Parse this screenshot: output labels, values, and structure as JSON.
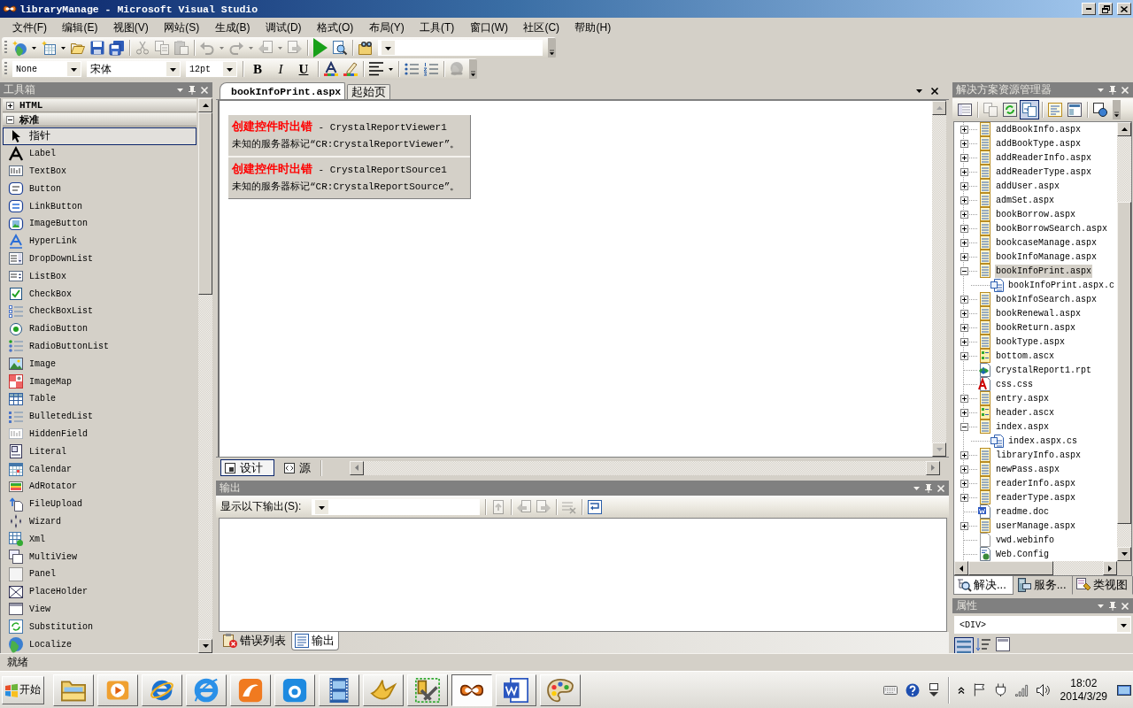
{
  "window": {
    "title": "libraryManage - Microsoft Visual Studio"
  },
  "menu": [
    "文件(F)",
    "编辑(E)",
    "视图(V)",
    "网站(S)",
    "生成(B)",
    "调试(D)",
    "格式(O)",
    "布局(Y)",
    "工具(T)",
    "窗口(W)",
    "社区(C)",
    "帮助(H)"
  ],
  "standard_toolbar": {
    "tool_groups": [
      [
        {
          "kind": "new-project",
          "disabled": false,
          "dropdown": true
        },
        {
          "kind": "add-item",
          "disabled": false,
          "dropdown": true
        },
        {
          "kind": "open",
          "disabled": false,
          "dropdown": false
        },
        {
          "kind": "save",
          "disabled": false,
          "dropdown": false
        },
        {
          "kind": "save-all",
          "disabled": false,
          "dropdown": false
        }
      ],
      [
        {
          "kind": "cut",
          "disabled": true,
          "dropdown": false
        },
        {
          "kind": "copy",
          "disabled": true,
          "dropdown": false
        },
        {
          "kind": "paste",
          "disabled": true,
          "dropdown": false
        }
      ],
      [
        {
          "kind": "undo",
          "disabled": true,
          "dropdown": true
        },
        {
          "kind": "redo",
          "disabled": true,
          "dropdown": true
        },
        {
          "kind": "back",
          "disabled": true,
          "dropdown": true
        },
        {
          "kind": "forward",
          "disabled": true,
          "dropdown": false
        }
      ],
      [
        {
          "kind": "start",
          "disabled": false,
          "dropdown": false
        },
        {
          "kind": "browse",
          "disabled": false,
          "dropdown": false
        }
      ],
      [
        {
          "kind": "find-in-files",
          "disabled": false,
          "dropdown": false
        }
      ]
    ]
  },
  "format_toolbar": {
    "block_format": "None",
    "font": "宋体",
    "size": "12pt",
    "styles": [
      {
        "label": "B",
        "kind": "bold"
      },
      {
        "label": "I",
        "kind": "italic"
      },
      {
        "label": "U",
        "kind": "underline"
      }
    ],
    "tool_groups": [
      [
        {
          "kind": "font-color",
          "disabled": false,
          "dropdown": false
        },
        {
          "kind": "highlight",
          "disabled": false,
          "dropdown": false
        }
      ],
      [
        {
          "kind": "align",
          "disabled": false,
          "dropdown": true
        }
      ],
      [
        {
          "kind": "bullets",
          "disabled": false,
          "dropdown": false
        },
        {
          "kind": "numbering",
          "disabled": false,
          "dropdown": false
        }
      ],
      [
        {
          "kind": "link",
          "disabled": true,
          "dropdown": false
        }
      ]
    ]
  },
  "toolbox": {
    "title": "工具箱",
    "groups": [
      {
        "label": "HTML",
        "expanded": false
      },
      {
        "label": "标准",
        "expanded": true,
        "items": [
          {
            "label": "指针",
            "kind": "pointer",
            "selected": true
          },
          {
            "label": "Label",
            "kind": "letter",
            "selected": false
          },
          {
            "label": "TextBox",
            "kind": "textbox",
            "selected": false
          },
          {
            "label": "Button",
            "kind": "button",
            "selected": false
          },
          {
            "label": "LinkButton",
            "kind": "linkbutton",
            "selected": false
          },
          {
            "label": "ImageButton",
            "kind": "imagebutton",
            "selected": false
          },
          {
            "label": "HyperLink",
            "kind": "hyperlink",
            "selected": false
          },
          {
            "label": "DropDownList",
            "kind": "dropdown",
            "selected": false
          },
          {
            "label": "ListBox",
            "kind": "listbox",
            "selected": false
          },
          {
            "label": "CheckBox",
            "kind": "checkbox",
            "selected": false
          },
          {
            "label": "CheckBoxList",
            "kind": "checklist",
            "selected": false
          },
          {
            "label": "RadioButton",
            "kind": "radio",
            "selected": false
          },
          {
            "label": "RadioButtonList",
            "kind": "radiolist",
            "selected": false
          },
          {
            "label": "Image",
            "kind": "image",
            "selected": false
          },
          {
            "label": "ImageMap",
            "kind": "imagemap",
            "selected": false
          },
          {
            "label": "Table",
            "kind": "table",
            "selected": false
          },
          {
            "label": "BulletedList",
            "kind": "bulletlist",
            "selected": false
          },
          {
            "label": "HiddenField",
            "kind": "hidden",
            "selected": false
          },
          {
            "label": "Literal",
            "kind": "literal",
            "selected": false
          },
          {
            "label": "Calendar",
            "kind": "calendar",
            "selected": false
          },
          {
            "label": "AdRotator",
            "kind": "adrotator",
            "selected": false
          },
          {
            "label": "FileUpload",
            "kind": "upload",
            "selected": false
          },
          {
            "label": "Wizard",
            "kind": "wizard",
            "selected": false
          },
          {
            "label": "Xml",
            "kind": "xml",
            "selected": false
          },
          {
            "label": "MultiView",
            "kind": "multiview",
            "selected": false
          },
          {
            "label": "Panel",
            "kind": "panel",
            "selected": false
          },
          {
            "label": "PlaceHolder",
            "kind": "placeholder",
            "selected": false
          },
          {
            "label": "View",
            "kind": "view",
            "selected": false
          },
          {
            "label": "Substitution",
            "kind": "substitution",
            "selected": false
          },
          {
            "label": "Localize",
            "kind": "localize",
            "selected": false
          }
        ]
      }
    ]
  },
  "editor": {
    "tabs": [
      {
        "label": "bookInfoPrint.aspx",
        "selected": true
      },
      {
        "label": "起始页",
        "selected": false
      }
    ],
    "errors": [
      {
        "title": "**创建控件时出错** - CrystalReportViewer1",
        "message": "未知的服务器标记“CR:CrystalReportViewer”。"
      },
      {
        "title": "**创建控件时出错** - CrystalReportSource1",
        "message": "未知的服务器标记“CR:CrystalReportSource”。"
      }
    ],
    "views": [
      {
        "label": "设计",
        "kind": "design",
        "selected": true
      },
      {
        "label": "源",
        "kind": "source",
        "selected": false
      }
    ]
  },
  "output": {
    "title": "输出",
    "filter_label": "显示以下输出(S):",
    "tool_groups": [
      [
        {
          "kind": "goto",
          "disabled": true
        }
      ],
      [
        {
          "kind": "prev",
          "disabled": true
        },
        {
          "kind": "next",
          "disabled": true
        }
      ],
      [
        {
          "kind": "clear",
          "disabled": true
        }
      ],
      [
        {
          "kind": "wrap",
          "disabled": false
        }
      ]
    ],
    "tabs": [
      {
        "label": "错误列表",
        "kind": "errors",
        "selected": false
      },
      {
        "label": "输出",
        "kind": "output",
        "selected": true
      }
    ]
  },
  "solution_explorer": {
    "title": "解决方案资源管理器",
    "tool_groups": [
      [
        {
          "kind": "properties",
          "disabled": false,
          "selected": false
        }
      ],
      [
        {
          "kind": "show-all",
          "disabled": true,
          "selected": false
        },
        {
          "kind": "refresh",
          "disabled": false,
          "selected": false
        },
        {
          "kind": "nest",
          "disabled": false,
          "selected": true
        }
      ],
      [
        {
          "kind": "view-code",
          "disabled": false,
          "selected": false
        },
        {
          "kind": "view-designer",
          "disabled": false,
          "selected": false
        }
      ],
      [
        {
          "kind": "copy-site",
          "disabled": false,
          "selected": false
        }
      ]
    ],
    "items": [
      {
        "label": "addBookInfo.aspx",
        "kind": "page",
        "expanded": false,
        "selected": false
      },
      {
        "label": "addBookType.aspx",
        "kind": "page",
        "expanded": false,
        "selected": false
      },
      {
        "label": "addReaderInfo.aspx",
        "kind": "page",
        "expanded": false,
        "selected": false
      },
      {
        "label": "addReaderType.aspx",
        "kind": "page",
        "expanded": false,
        "selected": false
      },
      {
        "label": "addUser.aspx",
        "kind": "page",
        "expanded": false,
        "selected": false
      },
      {
        "label": "admSet.aspx",
        "kind": "page",
        "expanded": false,
        "selected": false
      },
      {
        "label": "bookBorrow.aspx",
        "kind": "page",
        "expanded": false,
        "selected": false
      },
      {
        "label": "bookBorrowSearch.aspx",
        "kind": "page",
        "expanded": false,
        "selected": false
      },
      {
        "label": "bookcaseManage.aspx",
        "kind": "page",
        "expanded": false,
        "selected": false
      },
      {
        "label": "bookInfoManage.aspx",
        "kind": "page",
        "expanded": false,
        "selected": false
      },
      {
        "label": "bookInfoPrint.aspx",
        "kind": "page",
        "expanded": true,
        "selected": true,
        "children": [
          {
            "label": "bookInfoPrint.aspx.c",
            "kind": "code",
            "selected": false
          }
        ]
      },
      {
        "label": "bookInfoSearch.aspx",
        "kind": "page",
        "expanded": false,
        "selected": false
      },
      {
        "label": "bookRenewal.aspx",
        "kind": "page",
        "expanded": false,
        "selected": false
      },
      {
        "label": "bookReturn.aspx",
        "kind": "page",
        "expanded": false,
        "selected": false
      },
      {
        "label": "bookType.aspx",
        "kind": "page",
        "expanded": false,
        "selected": false
      },
      {
        "label": "bottom.ascx",
        "kind": "control",
        "expanded": false,
        "selected": false
      },
      {
        "label": "CrystalReport1.rpt",
        "kind": "report",
        "selected": false
      },
      {
        "label": "css.css",
        "kind": "stylesheet",
        "selected": false
      },
      {
        "label": "entry.aspx",
        "kind": "page",
        "expanded": false,
        "selected": false
      },
      {
        "label": "header.ascx",
        "kind": "control",
        "expanded": false,
        "selected": false
      },
      {
        "label": "index.aspx",
        "kind": "page",
        "expanded": true,
        "selected": false,
        "children": [
          {
            "label": "index.aspx.cs",
            "kind": "code",
            "selected": false
          }
        ]
      },
      {
        "label": "libraryInfo.aspx",
        "kind": "page",
        "expanded": false,
        "selected": false
      },
      {
        "label": "newPass.aspx",
        "kind": "page",
        "expanded": false,
        "selected": false
      },
      {
        "label": "readerInfo.aspx",
        "kind": "page",
        "expanded": false,
        "selected": false
      },
      {
        "label": "readerType.aspx",
        "kind": "page",
        "expanded": false,
        "selected": false
      },
      {
        "label": "readme.doc",
        "kind": "document",
        "selected": false
      },
      {
        "label": "userManage.aspx",
        "kind": "page",
        "expanded": false,
        "selected": false
      },
      {
        "label": "vwd.webinfo",
        "kind": "blank",
        "selected": false
      },
      {
        "label": "Web.Config",
        "kind": "config",
        "selected": false
      }
    ],
    "tabs": [
      {
        "label": "解决...",
        "kind": "solution",
        "selected": true
      },
      {
        "label": "服务...",
        "kind": "server",
        "selected": false
      },
      {
        "label": "类视图",
        "kind": "classes",
        "selected": false
      }
    ]
  },
  "properties": {
    "title": "属性",
    "object": "<DIV>",
    "tools": [
      {
        "kind": "categorized",
        "selected": true
      },
      {
        "kind": "alphabetical",
        "selected": false
      },
      {
        "kind": "pages",
        "selected": false
      }
    ]
  },
  "status_bar": {
    "text": "就绪"
  },
  "taskbar": {
    "start": "开始",
    "apps": [
      {
        "kind": "folder",
        "selected": false
      },
      {
        "kind": "media",
        "selected": false
      },
      {
        "kind": "browser-ring",
        "selected": false
      },
      {
        "kind": "browser",
        "selected": false
      },
      {
        "kind": "swirl-tile",
        "selected": false
      },
      {
        "kind": "round-tile",
        "selected": false
      },
      {
        "kind": "film",
        "selected": false
      },
      {
        "kind": "bird",
        "selected": false
      },
      {
        "kind": "tools",
        "selected": false
      },
      {
        "kind": "vs",
        "selected": true
      },
      {
        "kind": "word",
        "selected": false
      },
      {
        "kind": "palette",
        "selected": false
      }
    ],
    "clock": {
      "time": "18:02",
      "date": "2014/3/29"
    }
  }
}
